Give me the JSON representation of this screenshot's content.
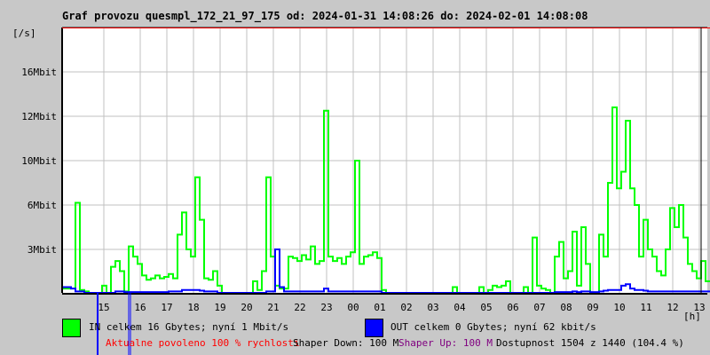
{
  "title": "Graf provozu quesmpl_172_21_97_175 od: 2024-01-31 14:08:26 do: 2024-02-01 14:08:08",
  "colors": {
    "in": "#00ff00",
    "out": "#0000ff",
    "grid": "#c0c0c0",
    "top_line": "#ff0000",
    "allowed": "#ff0000",
    "shaper_up": "#800080"
  },
  "chart_data": {
    "type": "line",
    "title": "Graf provozu quesmpl_172_21_97_175 od: 2024-01-31 14:08:26 do: 2024-02-01 14:08:08",
    "ylabel": "[/s]",
    "xlabel": "[h]",
    "y_ticks": [
      {
        "value": 3,
        "label": "3Mbit"
      },
      {
        "value": 6,
        "label": "6Mbit"
      },
      {
        "value": 10,
        "label": "10Mbit"
      },
      {
        "value": 12,
        "label": "12Mbit"
      },
      {
        "value": 16,
        "label": "16Mbit"
      }
    ],
    "ylim": [
      0,
      20
    ],
    "x_ticks": [
      "15",
      "16",
      "17",
      "18",
      "19",
      "20",
      "21",
      "22",
      "23",
      "00",
      "01",
      "02",
      "03",
      "04",
      "05",
      "06",
      "07",
      "08",
      "09",
      "10",
      "11",
      "12",
      "13"
    ],
    "sample_interval_minutes": 10,
    "grid": true,
    "series": [
      {
        "name": "IN",
        "unit": "Mbit/s",
        "values": [
          0.3,
          0.3,
          0.3,
          6.2,
          0.2,
          0.1,
          0,
          0,
          0,
          0.5,
          0,
          1.8,
          2.2,
          1.5,
          0.1,
          3.2,
          2.5,
          2.0,
          1.2,
          0.9,
          1.0,
          1.2,
          1.0,
          1.1,
          1.3,
          1.0,
          4.0,
          5.5,
          3.0,
          2.5,
          8.5,
          5.0,
          1.0,
          0.9,
          1.5,
          0.5,
          0,
          0,
          0,
          0,
          0,
          0,
          0,
          0.8,
          0.2,
          1.5,
          8.5,
          2.5,
          0.5,
          0.3,
          0.3,
          2.5,
          2.4,
          2.2,
          2.6,
          2.3,
          3.2,
          2.0,
          2.2,
          12.5,
          2.5,
          2.2,
          2.4,
          2.0,
          2.5,
          2.8,
          10,
          2.0,
          2.5,
          2.6,
          2.8,
          2.4,
          0.2,
          0,
          0,
          0,
          0,
          0,
          0,
          0,
          0,
          0,
          0,
          0,
          0,
          0,
          0,
          0,
          0.4,
          0,
          0,
          0,
          0,
          0,
          0.4,
          0,
          0.2,
          0.5,
          0.4,
          0.5,
          0.8,
          0,
          0,
          0,
          0.4,
          0,
          3.8,
          0.5,
          0.3,
          0.2,
          0,
          2.5,
          3.5,
          1.0,
          1.5,
          4.2,
          0.5,
          4.5,
          2.0,
          0,
          0,
          4.0,
          2.5,
          8,
          12.8,
          7.5,
          9,
          11.8,
          7.5,
          6,
          2.5,
          5,
          3,
          2.5,
          1.5,
          1.2,
          3,
          5.8,
          4.5,
          6,
          3.8,
          2.0,
          1.5,
          1.0,
          2.2,
          0.8
        ]
      },
      {
        "name": "OUT",
        "unit": "Mbit/s",
        "values": [
          0.4,
          0.4,
          0.3,
          0.1,
          0.1,
          0,
          0,
          0,
          0,
          0,
          0,
          0,
          0.1,
          0.1,
          0.05,
          0.05,
          0.05,
          0.05,
          0.05,
          0.05,
          0.05,
          0.05,
          0.05,
          0.05,
          0.1,
          0.1,
          0.1,
          0.2,
          0.2,
          0.2,
          0.2,
          0.15,
          0.1,
          0.1,
          0.1,
          0,
          0,
          0,
          0,
          0,
          0,
          0,
          0,
          0,
          0,
          0,
          0.1,
          0.1,
          3.0,
          0.4,
          0.1,
          0.1,
          0.1,
          0.1,
          0.1,
          0.1,
          0.1,
          0.1,
          0.1,
          0.3,
          0.1,
          0.1,
          0.1,
          0.1,
          0.1,
          0.1,
          0.1,
          0.1,
          0.1,
          0.1,
          0.1,
          0.1,
          0,
          0,
          0,
          0,
          0,
          0,
          0,
          0,
          0,
          0,
          0,
          0,
          0,
          0,
          0,
          0,
          0,
          0,
          0,
          0,
          0,
          0,
          0,
          0,
          0,
          0,
          0,
          0,
          0,
          0,
          0,
          0,
          0,
          0,
          0,
          0,
          0,
          0,
          0,
          0.05,
          0.05,
          0.05,
          0.05,
          0.1,
          0.05,
          0.1,
          0.1,
          0.05,
          0.05,
          0.1,
          0.15,
          0.2,
          0.2,
          0.2,
          0.5,
          0.6,
          0.3,
          0.2,
          0.2,
          0.15,
          0.1,
          0.1,
          0.1,
          0.1,
          0.1,
          0.1,
          0.1,
          0.1,
          0.1,
          0.1,
          0.1,
          0.1,
          0.1,
          0.1
        ]
      }
    ]
  },
  "legend": {
    "in_text": "IN celkem 16 Gbytes; nyní 1 Mbit/s",
    "out_text": "OUT celkem 0 Gbytes; nyní 62 kbit/s"
  },
  "status": {
    "allowed": "Aktualne povoleno 100 % rychlosti",
    "shaper_down": "Shaper Down: 100 M",
    "shaper_up": "Shaper Up: 100 M",
    "availability": "Dostupnost 1504 z 1440 (104.4 %)"
  }
}
